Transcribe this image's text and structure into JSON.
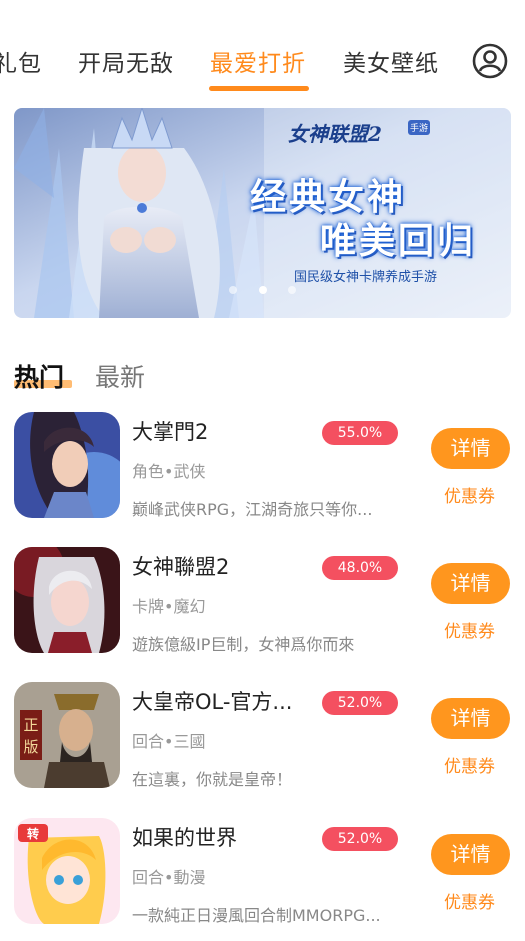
{
  "tabs": [
    {
      "label": "礼包"
    },
    {
      "label": "开局无敌"
    },
    {
      "label": "最爱打折"
    },
    {
      "label": "美女壁纸"
    }
  ],
  "active_tab": "最爱打折",
  "banner": {
    "title": "女神联盟2",
    "title_tag": "手游",
    "slogan_1": "经典女神",
    "slogan_2": "唯美回归",
    "tagline": "国民级女神卡牌养成手游"
  },
  "subtabs": {
    "hot": "热门",
    "new": "最新"
  },
  "games": [
    {
      "name": "大掌門2",
      "discount": "55.0%",
      "category": "角色•武侠",
      "desc": "巅峰武侠RPG，江湖奇旅只等你...",
      "detail": "详情",
      "coupon": "优惠券"
    },
    {
      "name": "女神聯盟2",
      "discount": "48.0%",
      "category": "卡牌•魔幻",
      "desc": "遊族億級IP巨制，女神爲你而來",
      "detail": "详情",
      "coupon": "优惠券"
    },
    {
      "name": "大皇帝OL-官方...",
      "discount": "52.0%",
      "category": "回合•三國",
      "desc": "在這裏，你就是皇帝！",
      "detail": "详情",
      "coupon": "优惠券"
    },
    {
      "name": "如果的世界",
      "discount": "52.0%",
      "category": "回合•動漫",
      "desc": "一款純正日漫風回合制MMORPG...",
      "detail": "详情",
      "coupon": "优惠券"
    }
  ],
  "icons": {
    "game_1": "wuxia-hero-avatar",
    "game_2": "goddess-avatar",
    "game_3": "emperor-avatar",
    "game_4": "anime-girl-avatar"
  },
  "colors": {
    "accent": "#ff8a1c",
    "discount": "#f45060",
    "button": "#ff961e"
  }
}
